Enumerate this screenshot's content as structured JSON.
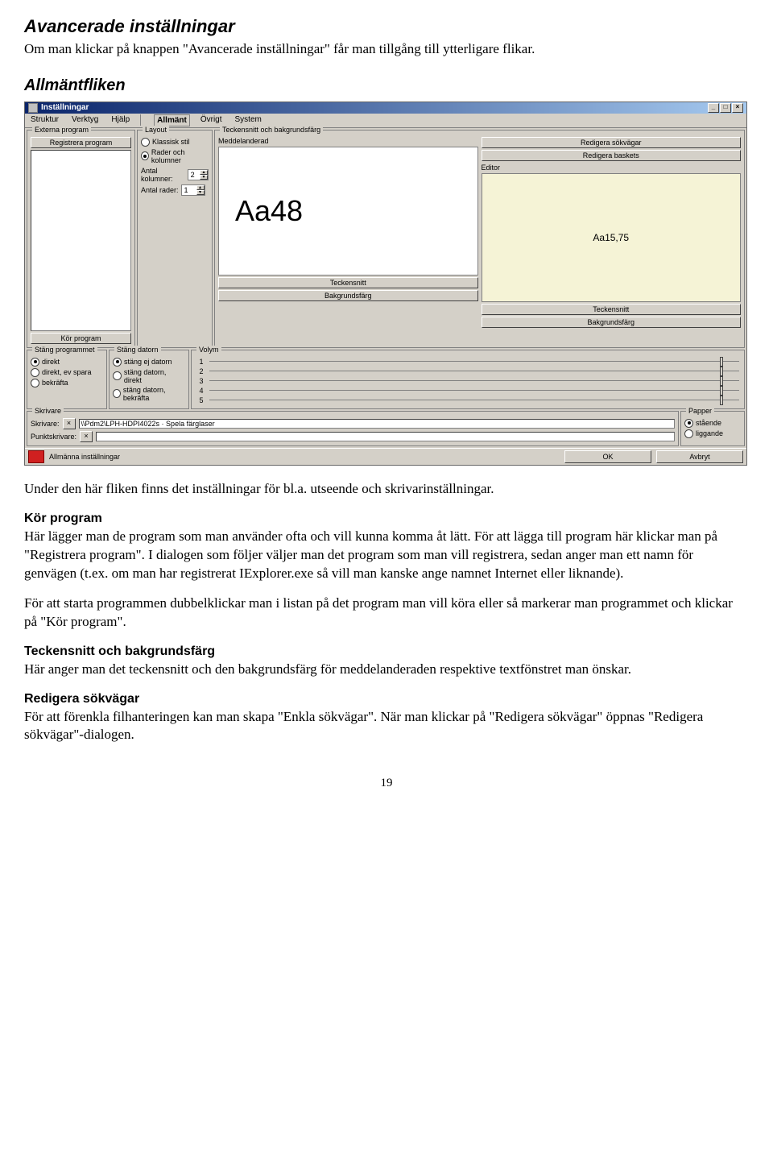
{
  "heading1": "Avancerade inställningar",
  "intro": "Om man klickar på knappen \"Avancerade inställningar\" får man tillgång till ytterligare flikar.",
  "heading2": "Allmäntfliken",
  "under_text": "Under den här fliken finns det inställningar för bl.a. utseende och skrivarinställningar.",
  "sec_kor": "Kör program",
  "kor_p1": "Här lägger man de program som man använder ofta och vill kunna komma åt lätt. För att lägga till program här klickar man på \"Registrera program\". I dialogen som följer väljer man det program som man vill registrera, sedan anger man ett namn för genvägen (t.ex. om man har registrerat IExplorer.exe så vill man kanske ange namnet Internet eller liknande).",
  "kor_p2": "För att starta programmen dubbelklickar man i listan på det program man vill köra eller så markerar man programmet och klickar på \"Kör program\".",
  "sec_font": "Teckensnitt och bakgrundsfärg",
  "font_p": "Här anger man det teckensnitt och den bakgrundsfärg för meddelanderaden respektive textfönstret man önskar.",
  "sec_paths": "Redigera sökvägar",
  "paths_p": "För att förenkla filhanteringen kan man skapa \"Enkla sökvägar\". När man klickar på \"Redigera sökvägar\" öppnas \"Redigera sökvägar\"-dialogen.",
  "page_num": "19",
  "win": {
    "title": "Inställningar",
    "menus": [
      "Struktur",
      "Verktyg",
      "Hjälp",
      "Allmänt",
      "Övrigt",
      "System"
    ],
    "externa": {
      "legend": "Externa program",
      "reg_btn": "Registrera program",
      "run_btn": "Kör program"
    },
    "layout": {
      "legend": "Layout",
      "r1": "Klassisk stil",
      "r2": "Rader och kolumner",
      "cols_lbl": "Antal kolumner:",
      "cols_val": "2",
      "rows_lbl": "Antal rader:",
      "rows_val": "1"
    },
    "fontbg": {
      "legend": "Teckensnitt och bakgrundsfärg",
      "msg_lbl": "Meddelanderad",
      "preview_big": "Aa48",
      "font_btn": "Teckensnitt",
      "bg_btn": "Bakgrundsfärg",
      "paths_btn": "Redigera sökvägar",
      "basket_btn": "Redigera baskets",
      "editor_lbl": "Editor",
      "preview_small": "Aa15,75"
    },
    "close_prog": {
      "legend": "Stäng programmet",
      "r1": "direkt",
      "r2": "direkt, ev spara",
      "r3": "bekräfta"
    },
    "close_pc": {
      "legend": "Stäng datorn",
      "r1": "stäng ej datorn",
      "r2": "stäng datorn, direkt",
      "r3": "stäng datorn, bekräfta"
    },
    "volume": {
      "legend": "Volym",
      "nums": [
        "1",
        "2",
        "3",
        "4",
        "5"
      ]
    },
    "printer": {
      "legend": "Skrivare",
      "lbl": "Skrivare:",
      "val": "\\\\Pdm2\\LPH-HDPI4022s · Spela färglaser",
      "dots_lbl": "Punktskrivare:"
    },
    "paper": {
      "legend": "Papper",
      "r1": "stående",
      "r2": "liggande"
    },
    "status": {
      "text": "Allmänna inställningar",
      "ok": "OK",
      "cancel": "Avbryt"
    }
  }
}
